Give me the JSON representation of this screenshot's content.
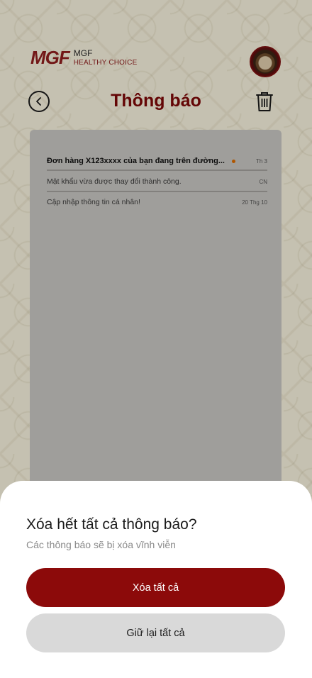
{
  "header": {
    "logo_mark": "MGF",
    "logo_line1": "MGF",
    "logo_line2": "HEALTHY CHOICE",
    "title": "Thông báo"
  },
  "notifications": [
    {
      "message": "Đơn hàng X123xxxx của bạn đang trên đường...",
      "time": "Th 3",
      "unread": true
    },
    {
      "message": "Mật khẩu vừa được thay đổi thành công.",
      "time": "CN",
      "unread": false
    },
    {
      "message": "Cập nhập thông tin cá nhân!",
      "time": "20 Thg 10",
      "unread": false
    }
  ],
  "dialog": {
    "title": "Xóa hết tất cả thông báo?",
    "subtitle": "Các thông báo sẽ bị xóa vĩnh viễn",
    "confirm_label": "Xóa tất cả",
    "cancel_label": "Giữ lại tất cả"
  },
  "colors": {
    "brand": "#8c0a0a",
    "unread_dot": "#d66a00",
    "secondary_button": "#d9d9d9"
  },
  "icons": {
    "back": "chevron-left-icon",
    "delete": "trash-icon"
  }
}
